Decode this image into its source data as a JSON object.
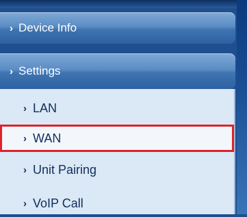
{
  "nav": {
    "device_info": {
      "label": "Device Info",
      "arrow": "›"
    },
    "settings": {
      "label": "Settings",
      "arrow": "›"
    }
  },
  "settings_menu": {
    "items": [
      {
        "label": "LAN",
        "arrow": "›"
      },
      {
        "label": "WAN",
        "arrow": "›",
        "selected": true
      },
      {
        "label": "Unit Pairing",
        "arrow": "›"
      },
      {
        "label": "VoIP Call",
        "arrow": "›"
      }
    ]
  },
  "colors": {
    "highlight_border": "#e0222a",
    "nav_button": "#3f74b1",
    "submenu_bg": "#dbe8f5"
  }
}
